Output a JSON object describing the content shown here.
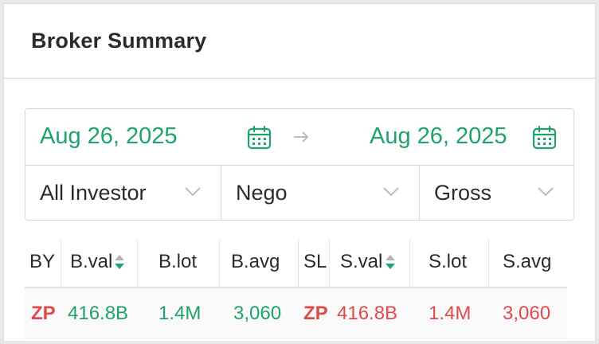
{
  "header": {
    "title": "Broker Summary"
  },
  "filters": {
    "date_from": "Aug 26, 2025",
    "date_to": "Aug 26, 2025",
    "investor": "All Investor",
    "market": "Nego",
    "value_type": "Gross"
  },
  "table": {
    "columns": {
      "buyer": "BY",
      "buy_value": "B.val",
      "buy_lot": "B.lot",
      "buy_avg": "B.avg",
      "seller": "SL",
      "sell_value": "S.val",
      "sell_lot": "S.lot",
      "sell_avg": "S.avg"
    },
    "rows": [
      {
        "buyer": "ZP",
        "buy_value": "416.8B",
        "buy_lot": "1.4M",
        "buy_avg": "3,060",
        "seller": "ZP",
        "sell_value": "416.8B",
        "sell_lot": "1.4M",
        "sell_avg": "3,060"
      }
    ]
  },
  "colors": {
    "buy": "#1fa36a",
    "sell": "#e24a4a",
    "text": "#2b2b2b",
    "border": "#d7d7d7"
  },
  "icons": {
    "calendar": "calendar-icon",
    "arrow": "arrow-right-icon",
    "chevron": "chevron-down-icon",
    "sort": "sort-icon"
  }
}
